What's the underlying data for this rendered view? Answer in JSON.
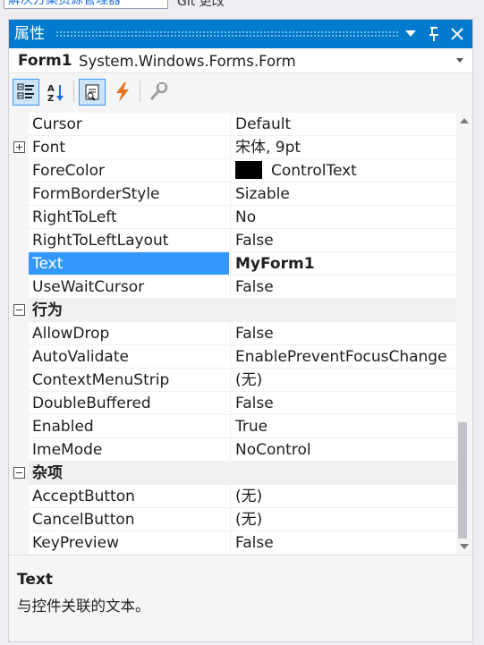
{
  "top_strip": {
    "tab_text": "解决方案资源管理器",
    "hint_text": "Git 更改"
  },
  "panel": {
    "title": "属性",
    "title_buttons": [
      "chevron-down-icon",
      "pin-icon",
      "close-icon"
    ]
  },
  "object_selector": {
    "name": "Form1",
    "type": "System.Windows.Forms.Form"
  },
  "toolbar": {
    "buttons": [
      {
        "icon": "categorized-icon",
        "pressed": true
      },
      {
        "icon": "alphabetical-icon",
        "pressed": false
      },
      {
        "icon": "properties-icon",
        "pressed": true
      },
      {
        "icon": "events-icon",
        "pressed": false
      },
      {
        "icon": "property-pages-icon",
        "pressed": false
      }
    ]
  },
  "grid": {
    "rows": [
      {
        "kind": "prop",
        "name": "Cursor",
        "value": "Default"
      },
      {
        "kind": "prop",
        "name": "Font",
        "value": "宋体, 9pt",
        "expandable": true
      },
      {
        "kind": "prop",
        "name": "ForeColor",
        "value": "ControlText",
        "swatch": "#000000"
      },
      {
        "kind": "prop",
        "name": "FormBorderStyle",
        "value": "Sizable"
      },
      {
        "kind": "prop",
        "name": "RightToLeft",
        "value": "No"
      },
      {
        "kind": "prop",
        "name": "RightToLeftLayout",
        "value": "False"
      },
      {
        "kind": "prop",
        "name": "Text",
        "value": "MyForm1",
        "selected": true
      },
      {
        "kind": "prop",
        "name": "UseWaitCursor",
        "value": "False"
      },
      {
        "kind": "category",
        "name": "行为"
      },
      {
        "kind": "prop",
        "name": "AllowDrop",
        "value": "False"
      },
      {
        "kind": "prop",
        "name": "AutoValidate",
        "value": "EnablePreventFocusChange"
      },
      {
        "kind": "prop",
        "name": "ContextMenuStrip",
        "value": "(无)"
      },
      {
        "kind": "prop",
        "name": "DoubleBuffered",
        "value": "False"
      },
      {
        "kind": "prop",
        "name": "Enabled",
        "value": "True"
      },
      {
        "kind": "prop",
        "name": "ImeMode",
        "value": "NoControl"
      },
      {
        "kind": "category",
        "name": "杂项"
      },
      {
        "kind": "prop",
        "name": "AcceptButton",
        "value": "(无)"
      },
      {
        "kind": "prop",
        "name": "CancelButton",
        "value": "(无)"
      },
      {
        "kind": "prop",
        "name": "KeyPreview",
        "value": "False"
      }
    ]
  },
  "description": {
    "title": "Text",
    "text": "与控件关联的文本。"
  },
  "colors": {
    "title_bar": "#007acc",
    "selection": "#3399ff",
    "events_icon": "#e8731e"
  }
}
